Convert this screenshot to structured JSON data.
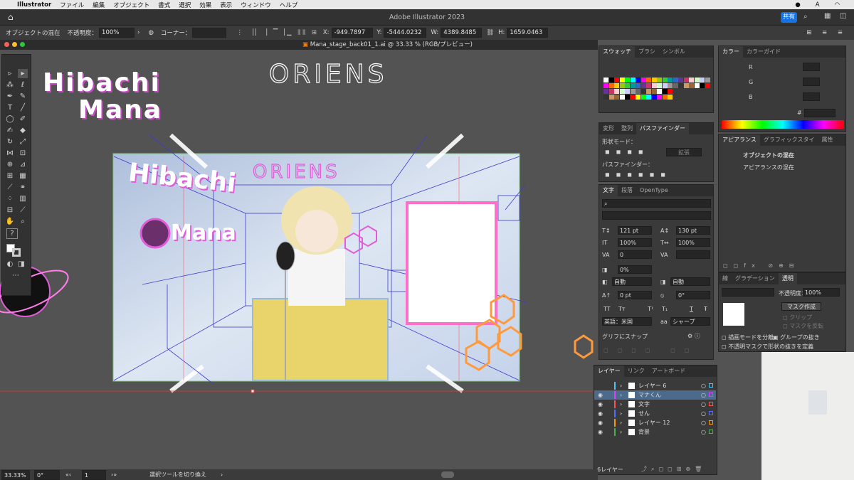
{
  "menubar": {
    "app": "Illustrator",
    "items": [
      "ファイル",
      "編集",
      "オブジェクト",
      "書式",
      "選択",
      "効果",
      "表示",
      "ウィンドウ",
      "ヘルプ"
    ]
  },
  "titlebar": {
    "title": "Adobe Illustrator 2023",
    "share": "共有"
  },
  "controlbar": {
    "object_label": "オブジェクトの混在",
    "opacity_label": "不透明度：",
    "opacity": "100%",
    "corner_label": "コーナー：",
    "x_label": "X:",
    "x": "-949.7897",
    "y_label": "Y:",
    "y": "-5444.0232",
    "w_label": "W:",
    "w": "4389.8485",
    "h_label": "H:",
    "h": "1659.0463"
  },
  "document": {
    "tab": "Mana_stage_back01_1.ai @ 33.33 % (RGB/プレビュー)"
  },
  "artwork": {
    "title_line1": "Hibachi",
    "title_line2": "Mana",
    "logo": "ORIENS",
    "inner_title1": "Hibachi",
    "inner_title2": "Mana"
  },
  "swatches_panel": {
    "tabs": [
      "スウォッチ",
      "ブラシ",
      "シンボル"
    ]
  },
  "color_panel": {
    "tabs": [
      "カラー",
      "カラーガイド"
    ],
    "r": "R",
    "g": "G",
    "b": "B",
    "hash": "#"
  },
  "pathfinder_panel": {
    "tabs": [
      "変形",
      "整列",
      "パスファインダー"
    ],
    "shape_modes": "形状モード：",
    "pathfinders": "パスファインダー：",
    "expand": "拡張"
  },
  "appearance_panel": {
    "tabs": [
      "アピアランス",
      "グラフィックスタイ",
      "属性"
    ],
    "object": "オブジェクトの混在",
    "item": "アピアランスの混在"
  },
  "character_panel": {
    "tabs": [
      "文字",
      "段落",
      "OpenType"
    ],
    "size": "121 pt",
    "leading": "130 pt",
    "hscale": "100%",
    "vscale": "100%",
    "kern": "0",
    "tracking": "0%",
    "auto1": "自動",
    "auto2": "自動",
    "shift": "0 pt",
    "rotate": "0°",
    "lang": "英語：米国",
    "aa": "シャープ",
    "snap": "グリフにスナップ",
    "tt1": "TT",
    "tt2": "Tт",
    "tt3": "T¹",
    "tt4": "T₁",
    "tt5": "T",
    "tt6": "Ŧ"
  },
  "transparency_panel": {
    "tabs": [
      "線",
      "グラデーション",
      "透明"
    ],
    "opacity_label": "不透明度：",
    "opacity": "100%",
    "mask_btn": "マスク作成",
    "clip": "クリップ",
    "invert": "マスクを反転",
    "isolate": "描画モードを分離",
    "knockout": "グループの抜き",
    "opacity_mask": "不透明マスクで形状の抜きを定義"
  },
  "layers_panel": {
    "tabs": [
      "レイヤー",
      "リンク",
      "アートボード"
    ],
    "layers": [
      {
        "name": "レイヤー 6",
        "color": "#4fc3f7",
        "visible": false
      },
      {
        "name": "マナくん",
        "color": "#e040fb",
        "visible": true
      },
      {
        "name": "文字",
        "color": "#ff5252",
        "visible": true
      },
      {
        "name": "せん",
        "color": "#536dfe",
        "visible": true
      },
      {
        "name": "レイヤー 12",
        "color": "#ff9800",
        "visible": true
      },
      {
        "name": "背景",
        "color": "#4caf50",
        "visible": true
      }
    ],
    "count": "6レイヤー"
  },
  "statusbar": {
    "zoom": "33.33%",
    "angle": "0°",
    "artboard": "1",
    "tool_hint": "選択ツールを切り換え"
  },
  "colors": {
    "accent": "#1473e6",
    "canvas": "#535353",
    "panel": "#3a3a3a",
    "pink": "#e05cd8"
  }
}
